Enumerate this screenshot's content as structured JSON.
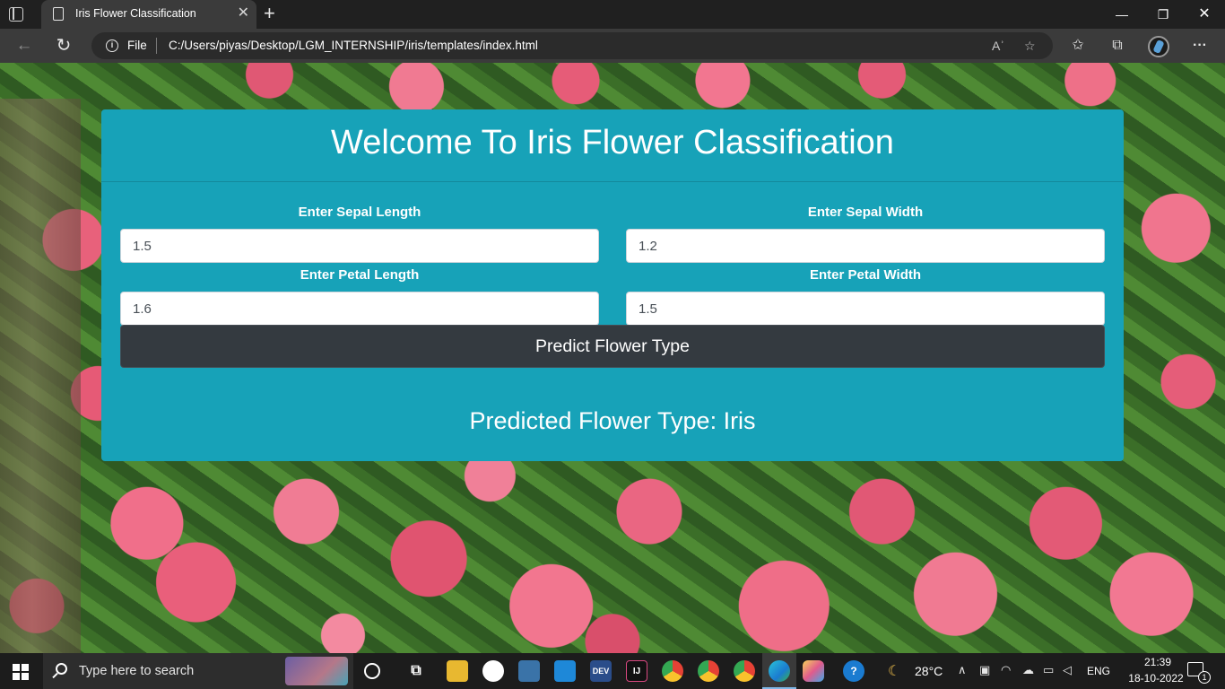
{
  "browser": {
    "tab_title": "Iris Flower Classification",
    "tab_close": "✕",
    "new_tab": "+",
    "scheme_label": "File",
    "url": "C:/Users/piyas/Desktop/LGM_INTERNSHIP/iris/templates/index.html",
    "window_controls": {
      "minimize": "—",
      "maximize": "❐",
      "close": "✕"
    },
    "nav": {
      "back": "←",
      "reload": "↻"
    },
    "toolbar_icons": {
      "read_aloud": "Aʾ",
      "add_favorite": "☆",
      "favorites": "✩",
      "collections": "⧉",
      "more": "···"
    }
  },
  "page": {
    "title": "Welcome To Iris Flower Classification",
    "fields": [
      {
        "label": "Enter Sepal Length",
        "value": "1.5"
      },
      {
        "label": "Enter Sepal Width",
        "value": "1.2"
      },
      {
        "label": "Enter Petal Length",
        "value": "1.6"
      },
      {
        "label": "Enter Petal Width",
        "value": "1.5"
      }
    ],
    "submit_label": "Predict Flower Type",
    "result_text": "Predicted Flower Type: Iris"
  },
  "taskbar": {
    "search_placeholder": "Type here to search",
    "weather_temp": "28°C",
    "language": "ENG",
    "time": "21:39",
    "date": "18-10-2022",
    "notification_count": "1",
    "app_labels": {
      "devc": "DEV",
      "ij": "IJ",
      "help": "?"
    }
  },
  "colors": {
    "card": "#17a2b8",
    "button": "#343a40",
    "text": "#ffffff"
  }
}
